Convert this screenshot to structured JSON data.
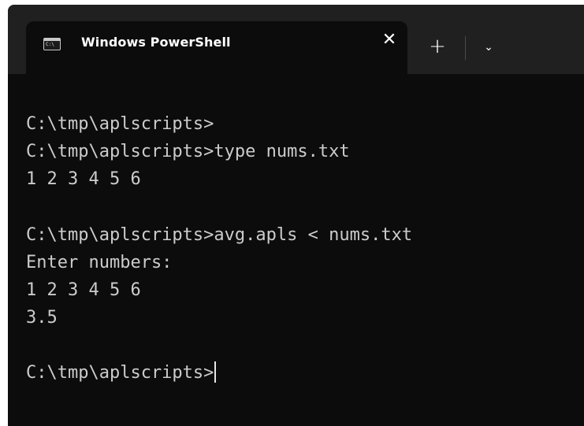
{
  "tab": {
    "icon": "powershell-console-icon",
    "title": "Windows PowerShell",
    "close_glyph": "✕"
  },
  "titlebar": {
    "new_tab_glyph": "+",
    "dropdown_glyph": "⌄"
  },
  "terminal": {
    "lines": [
      "C:\\tmp\\aplscripts>",
      "C:\\tmp\\aplscripts>type nums.txt",
      "1 2 3 4 5 6",
      "",
      "C:\\tmp\\aplscripts>avg.apls < nums.txt",
      "Enter numbers:",
      "1 2 3 4 5 6",
      "3.5",
      "",
      "C:\\tmp\\aplscripts>"
    ]
  },
  "colors": {
    "terminal_bg": "#0c0c0c",
    "titlebar_bg": "#202020",
    "text": "#cccccc"
  }
}
